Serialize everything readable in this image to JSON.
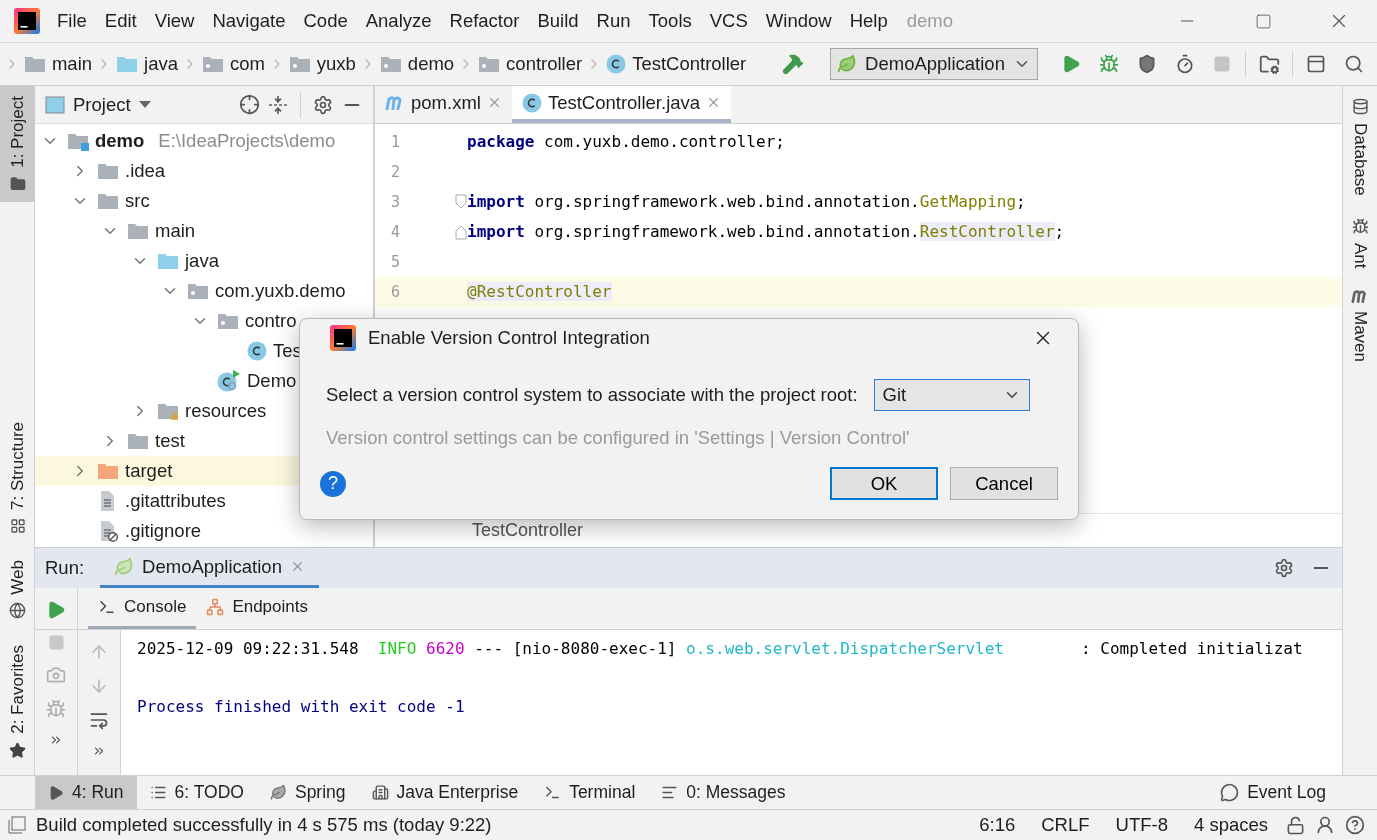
{
  "menu_bar": {
    "items": [
      "File",
      "Edit",
      "View",
      "Navigate",
      "Code",
      "Analyze",
      "Refactor",
      "Build",
      "Run",
      "Tools",
      "VCS",
      "Window",
      "Help"
    ],
    "title": "demo"
  },
  "nav_bar": {
    "breadcrumbs": [
      {
        "label": "main",
        "kind": "folder"
      },
      {
        "label": "java",
        "kind": "source"
      },
      {
        "label": "com",
        "kind": "package"
      },
      {
        "label": "yuxb",
        "kind": "package"
      },
      {
        "label": "demo",
        "kind": "package"
      },
      {
        "label": "controller",
        "kind": "package"
      },
      {
        "label": "TestController",
        "kind": "class"
      }
    ],
    "run_config": "DemoApplication"
  },
  "left_strip": {
    "top": [
      {
        "label": "1: Project",
        "kind": "project",
        "selected": true
      }
    ],
    "bottom": [
      {
        "label": "7: Structure",
        "kind": "structure",
        "selected": false
      },
      {
        "label": "Web",
        "kind": "web",
        "selected": false
      },
      {
        "label": "2: Favorites",
        "kind": "favorites",
        "selected": false
      }
    ]
  },
  "project_panel": {
    "title": "Project",
    "tree": [
      {
        "label": "demo",
        "path": "E:\\IdeaProjects\\demo",
        "kind": "module",
        "expanded": true,
        "selected": false,
        "children": [
          {
            "label": ".idea",
            "kind": "folder",
            "expanded": false,
            "selected": false
          },
          {
            "label": "src",
            "kind": "folder",
            "expanded": true,
            "selected": false,
            "children": [
              {
                "label": "main",
                "kind": "folder",
                "expanded": true,
                "selected": false,
                "children": [
                  {
                    "label": "java",
                    "kind": "source",
                    "expanded": true,
                    "selected": false,
                    "children": [
                      {
                        "label": "com.yuxb.demo",
                        "kind": "package",
                        "expanded": true,
                        "selected": false,
                        "children": [
                          {
                            "label": "contro",
                            "kind": "package",
                            "expanded": true,
                            "selected": false,
                            "children": [
                              {
                                "label": "Tes",
                                "kind": "class",
                                "selected": false
                              }
                            ]
                          },
                          {
                            "label": "Demo",
                            "kind": "app",
                            "selected": false
                          }
                        ]
                      }
                    ]
                  },
                  {
                    "label": "resources",
                    "kind": "resources",
                    "expanded": false,
                    "selected": false
                  }
                ]
              },
              {
                "label": "test",
                "kind": "folder",
                "expanded": false,
                "selected": false
              }
            ]
          },
          {
            "label": "target",
            "kind": "excluded",
            "expanded": false,
            "selected": true
          },
          {
            "label": ".gitattributes",
            "kind": "file",
            "selected": false
          },
          {
            "label": ".gitignore",
            "kind": "ignored",
            "selected": false
          }
        ]
      }
    ]
  },
  "editor": {
    "tabs": [
      {
        "label": "pom.xml",
        "kind": "maven",
        "selected": false
      },
      {
        "label": "TestController.java",
        "kind": "class",
        "selected": true
      }
    ],
    "lines": [
      {
        "number": "1",
        "current": false,
        "tokens": [
          {
            "text": "package",
            "kind": "keyword"
          },
          {
            "text": " com.yuxb.demo.controller;",
            "kind": "plain"
          }
        ]
      },
      {
        "number": "2",
        "current": false
      },
      {
        "number": "3",
        "current": false,
        "fold_start": true,
        "tokens": [
          {
            "text": "import",
            "kind": "keyword"
          },
          {
            "text": " org.springframework.web.bind.annotation.",
            "kind": "plain"
          },
          {
            "text": "GetMapping",
            "kind": "ref"
          },
          {
            "text": ";",
            "kind": "plain"
          }
        ]
      },
      {
        "number": "4",
        "current": false,
        "fold_end": true,
        "tokens": [
          {
            "text": "import",
            "kind": "keyword"
          },
          {
            "text": " org.springframework.web.bind.annotation.",
            "kind": "plain"
          },
          {
            "text": "RestController",
            "kind": "ref-marked"
          },
          {
            "text": ";",
            "kind": "plain"
          }
        ]
      },
      {
        "number": "5",
        "current": false
      },
      {
        "number": "6",
        "current": true,
        "tokens": [
          {
            "text": "@RestController",
            "kind": "ref-marked"
          }
        ]
      }
    ],
    "breadcrumb": "TestController"
  },
  "right_strip": [
    {
      "label": "Database",
      "kind": "database"
    },
    {
      "label": "Ant",
      "kind": "ant"
    },
    {
      "label": "Maven",
      "kind": "maven"
    }
  ],
  "run_panel": {
    "label": "Run:",
    "tabs": [
      {
        "label": "DemoApplication",
        "selected": true
      }
    ],
    "subtabs": [
      {
        "label": "Console",
        "kind": "console",
        "selected": true
      },
      {
        "label": "Endpoints",
        "kind": "endpoints",
        "selected": false
      }
    ],
    "console": [
      {
        "kind": "log",
        "segments": [
          {
            "text": "2025-12-09 09:22:31.548  ",
            "kind": "plain"
          },
          {
            "text": "INFO",
            "kind": "level"
          },
          {
            "text": " 6620",
            "kind": "pid"
          },
          {
            "text": " --- [nio-8080-exec-1] ",
            "kind": "plain"
          },
          {
            "text": "o.s.web.servlet.DispatcherServlet",
            "kind": "logger"
          },
          {
            "text": "        : Completed initializat",
            "kind": "plain"
          }
        ]
      },
      {
        "kind": "exit",
        "segments": [
          {
            "text": "Process finished with exit code -1",
            "kind": "exit"
          }
        ]
      }
    ]
  },
  "tool_tabs": {
    "left": [
      {
        "label": "4: Run",
        "kind": "run",
        "selected": true
      },
      {
        "label": "6: TODO",
        "kind": "todo",
        "selected": false
      },
      {
        "label": "Spring",
        "kind": "spring",
        "selected": false
      },
      {
        "label": "Java Enterprise",
        "kind": "enterprise",
        "selected": false
      },
      {
        "label": "Terminal",
        "kind": "terminal",
        "selected": false
      },
      {
        "label": "0: Messages",
        "kind": "messages",
        "selected": false
      }
    ],
    "right": [
      {
        "label": "Event Log",
        "kind": "log",
        "selected": false
      }
    ]
  },
  "status_bar": {
    "message": "Build completed successfully in 4 s 575 ms (today 9:22)",
    "items": [
      "6:16",
      "CRLF",
      "UTF-8",
      "4 spaces"
    ]
  },
  "dialog": {
    "title": "Enable Version Control Integration",
    "prompt": "Select a version control system to associate with the project root:",
    "value": "Git",
    "hint": "Version control settings can be configured in 'Settings | Version Control'",
    "help": "?",
    "buttons": [
      {
        "label": "OK",
        "default": true
      },
      {
        "label": "Cancel",
        "default": false
      }
    ]
  }
}
